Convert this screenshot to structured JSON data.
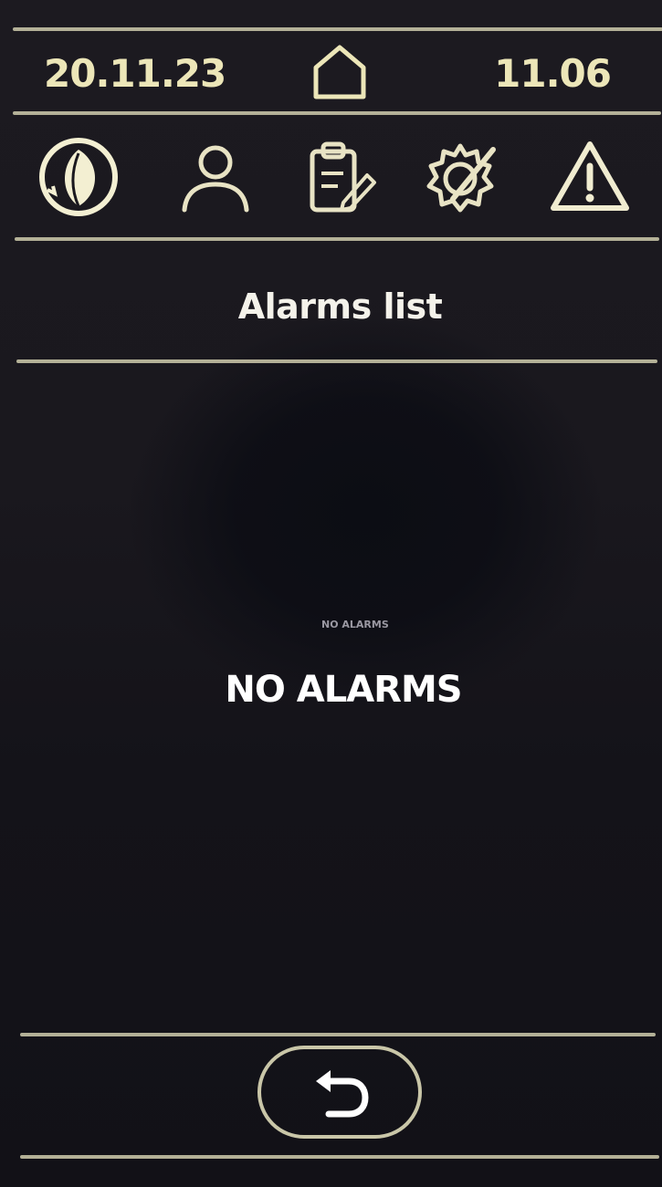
{
  "header": {
    "date": "20.11.23",
    "time": "11.06",
    "home_icon": "home-icon"
  },
  "toolbar": {
    "icons": [
      "leaf-eco-icon",
      "user-icon",
      "clipboard-edit-icon",
      "gear-wrench-icon",
      "warning-icon"
    ]
  },
  "page": {
    "title": "Alarms list",
    "caption": "NO ALARMS",
    "empty_message": "NO ALARMS"
  },
  "footer": {
    "back_icon": "back-arrow-icon"
  },
  "colors": {
    "accent": "#ece6b8",
    "rule": "#c9c6a8",
    "background": "#1a181e"
  }
}
